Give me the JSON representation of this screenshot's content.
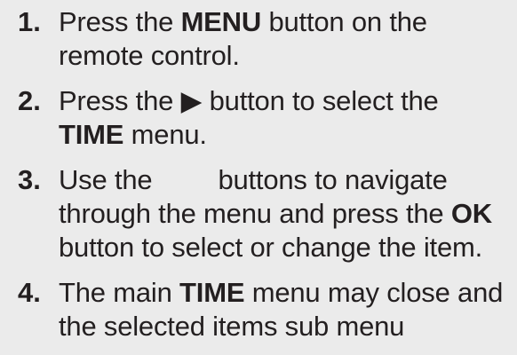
{
  "steps": [
    {
      "number": "1.",
      "before": "Press the ",
      "bold": "MENU",
      "after": " button on the remote control."
    },
    {
      "number": "2.",
      "before": "Press the ",
      "glyph": "▶",
      "after": " button to select the",
      "bold": "TIME",
      "tail": " menu."
    },
    {
      "number": "3.",
      "before": "Use the",
      "middle": "buttons to navigate through the menu and press the ",
      "bold": "OK",
      "after": "button to select or change the item."
    },
    {
      "number": "4.",
      "before": "The main ",
      "bold": "TIME",
      "after": " menu may close and the selected items sub menu"
    }
  ]
}
